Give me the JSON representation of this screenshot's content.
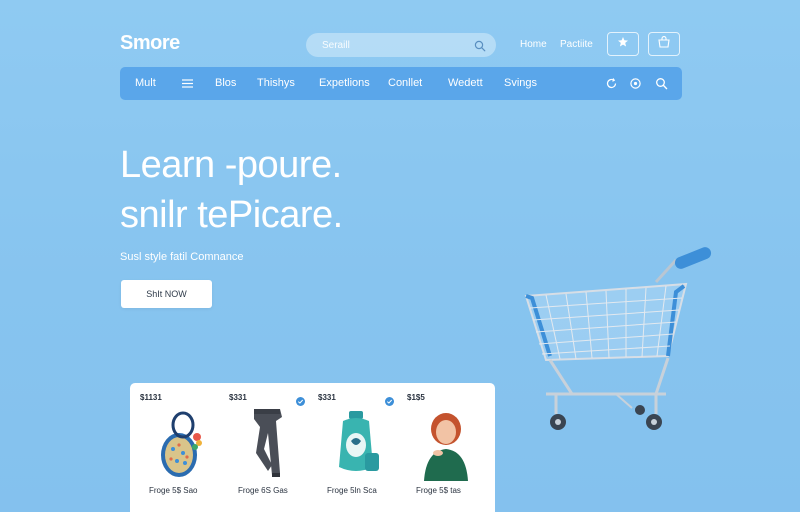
{
  "brand": {
    "logo_text": "Smore"
  },
  "header": {
    "search_placeholder": "Seraill",
    "links": [
      {
        "label": "Home"
      },
      {
        "label": "Pactiite"
      }
    ],
    "icon_buttons": [
      {
        "icon": "star-icon"
      },
      {
        "icon": "bag-icon"
      }
    ]
  },
  "nav": {
    "items": [
      {
        "label": "Mult"
      },
      {
        "label": "Blos"
      },
      {
        "label": "Thishys"
      },
      {
        "label": "Expetlions"
      },
      {
        "label": "Conllet"
      },
      {
        "label": "Wedett"
      },
      {
        "label": "Svings"
      }
    ],
    "menu_icon": "menu-icon",
    "right_icons": [
      "refresh-icon",
      "settings-icon",
      "search-icon"
    ]
  },
  "hero": {
    "title_line1": "Learn -poure.",
    "title_line2": "snilr tePicare.",
    "subtitle": "Susl style fatil Comnance",
    "cta_label": "ShIt NOW"
  },
  "products": [
    {
      "price": "$1131",
      "name": "Froge 5$ Sao",
      "badge": "",
      "image": "charm-bag"
    },
    {
      "price": "$331",
      "name": "Froge 6S Gas",
      "badge": "check-icon",
      "image": "pants"
    },
    {
      "price": "$331",
      "name": "Froge 5ln Sca",
      "badge": "check-icon",
      "image": "bottle"
    },
    {
      "price": "$1$5",
      "name": "Froge 5$ tas",
      "badge": "",
      "image": "person"
    }
  ],
  "colors": {
    "background": "#8fcaf2",
    "navbar": "#5aa6ea",
    "accent": "#3d8fd8",
    "text_dark": "#2a3340"
  }
}
